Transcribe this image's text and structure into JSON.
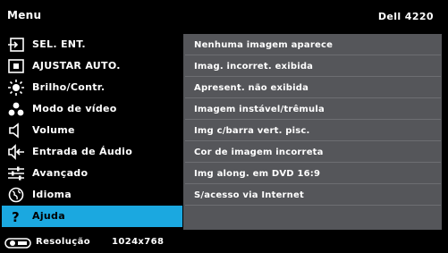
{
  "header": {
    "title": "Menu",
    "model": "Dell 4220"
  },
  "sidebar": {
    "items": [
      {
        "label": "SEL. ENT.",
        "icon": "input-source-icon"
      },
      {
        "label": "AJUSTAR AUTO.",
        "icon": "auto-adjust-icon"
      },
      {
        "label": "Brilho/Contr.",
        "icon": "brightness-icon"
      },
      {
        "label": "Modo de vídeo",
        "icon": "video-mode-icon"
      },
      {
        "label": "Volume",
        "icon": "speaker-icon"
      },
      {
        "label": "Entrada de Áudio",
        "icon": "audio-input-icon"
      },
      {
        "label": "Avançado",
        "icon": "sliders-icon"
      },
      {
        "label": "Idioma",
        "icon": "globe-icon"
      },
      {
        "label": "Ajuda",
        "icon": "question-icon",
        "active": true
      }
    ]
  },
  "panel": {
    "items": [
      "Nenhuma imagem aparece",
      "Imag. incorret. exibida",
      "Apresent. não exibida",
      "Imagem instável/trêmula",
      "Img c/barra vert. pisc.",
      "Cor de imagem incorreta",
      "Img along. em DVD 16:9",
      "S/acesso via Internet"
    ]
  },
  "footer": {
    "label": "Resolução",
    "value": "1024x768",
    "icon": "projector-icon"
  },
  "colors": {
    "accent": "#1ba8e0",
    "panel": "#55565a",
    "background": "#000000"
  }
}
